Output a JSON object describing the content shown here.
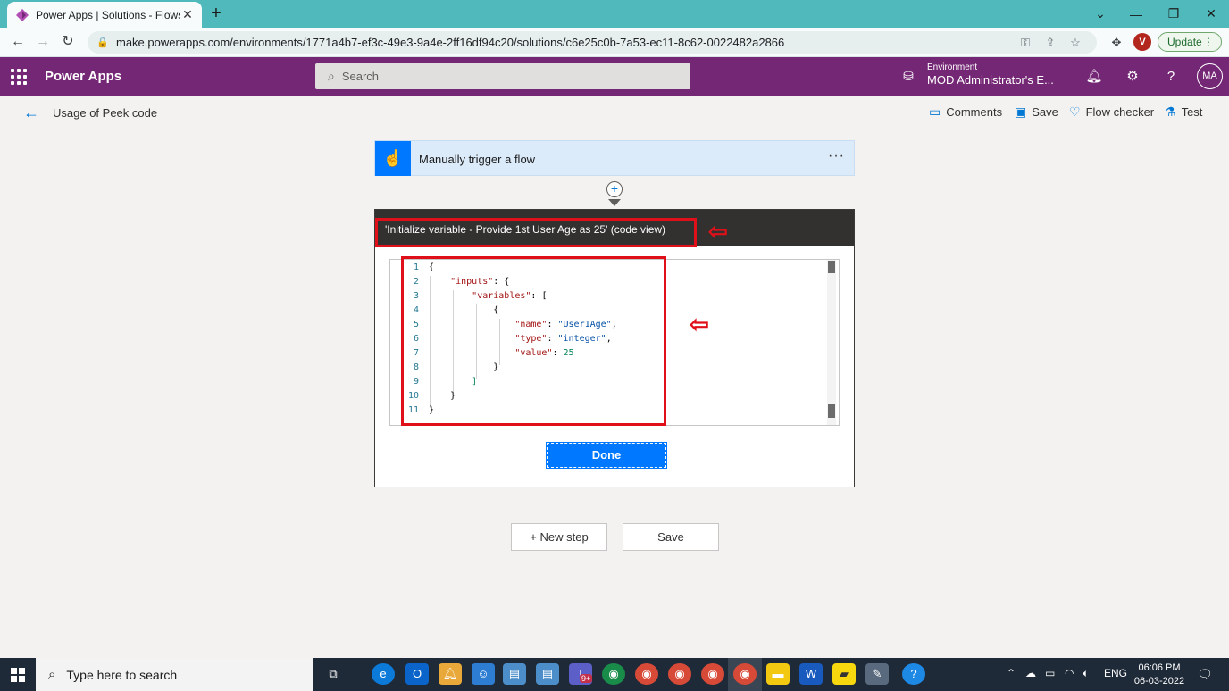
{
  "browser": {
    "tab_title": "Power Apps | Solutions - Flows",
    "url": "make.powerapps.com/environments/1771a4b7-ef3c-49e3-9a4e-2ff16df94c20/solutions/c6e25c0b-7a53-ec11-8c62-0022482a2866",
    "profile_initial": "V",
    "update_label": "Update"
  },
  "header": {
    "app_title": "Power Apps",
    "search_placeholder": "Search",
    "environment_label": "Environment",
    "environment_name": "MOD Administrator's E...",
    "user_initials": "MA"
  },
  "commandbar": {
    "flow_name": "Usage of Peek code",
    "comments": "Comments",
    "save": "Save",
    "flow_checker": "Flow checker",
    "test": "Test"
  },
  "trigger": {
    "label": "Manually trigger a flow",
    "more": "···"
  },
  "code_card": {
    "title": "'Initialize variable - Provide 1st User Age as 25' (code view)",
    "done_label": "Done",
    "line_numbers": [
      "1",
      "2",
      "3",
      "4",
      "5",
      "6",
      "7",
      "8",
      "9",
      "10",
      "11"
    ]
  },
  "footer_buttons": {
    "new_step": "+ New step",
    "save": "Save"
  },
  "taskbar": {
    "search_placeholder": "Type here to search",
    "language": "ENG",
    "time": "06:06 PM",
    "date": "06-03-2022",
    "notification_count": "9+"
  },
  "colors": {
    "header_purple": "#742774",
    "accent_blue": "#0078ff",
    "annotation_red": "#e0101a",
    "tab_strip": "#4fb9bb"
  }
}
